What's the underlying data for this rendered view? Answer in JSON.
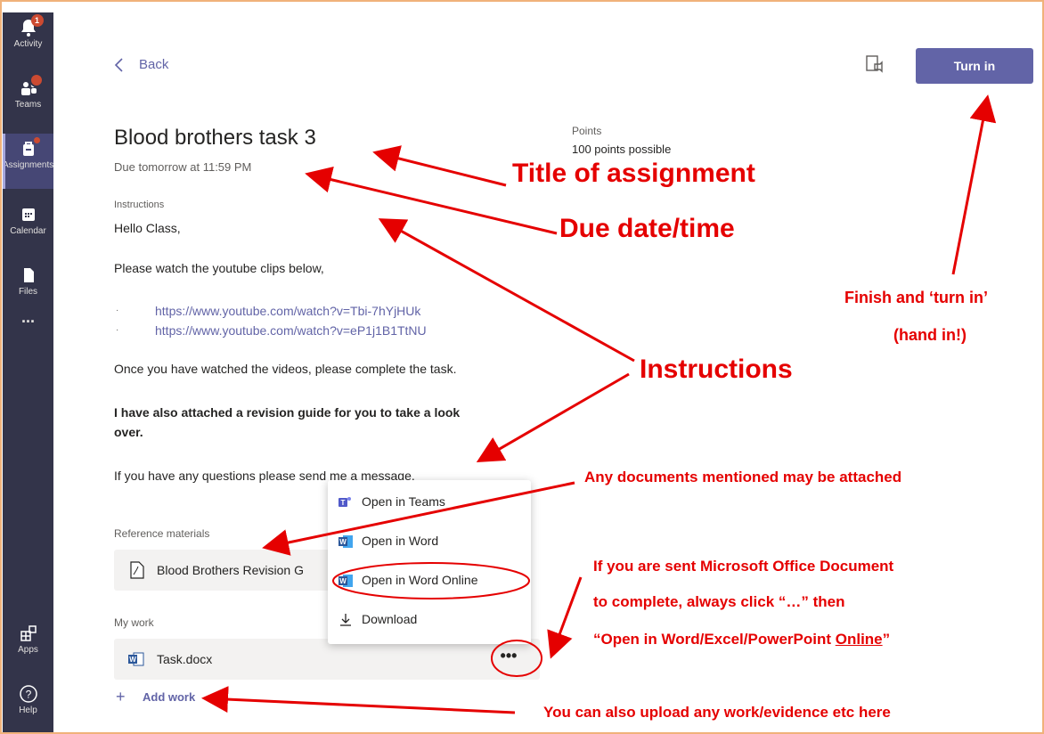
{
  "rail": {
    "items": [
      {
        "label": "Activity",
        "badge": "1"
      },
      {
        "label": "Teams"
      },
      {
        "label": "Assignments"
      },
      {
        "label": "Calendar"
      },
      {
        "label": "Files"
      },
      {
        "label": "..."
      },
      {
        "label": "Apps"
      },
      {
        "label": "Help"
      }
    ]
  },
  "header": {
    "back_label": "Back",
    "turn_in_label": "Turn in"
  },
  "assignment": {
    "title": "Blood brothers task 3",
    "due": "Due tomorrow at 11:59 PM",
    "points_label": "Points",
    "points_value": "100 points possible",
    "instructions_label": "Instructions",
    "greeting": "Hello Class,",
    "line1": "Please watch the youtube clips below,",
    "links": [
      "https://www.youtube.com/watch?v=Tbi-7hYjHUk",
      "https://www.youtube.com/watch?v=eP1j1B1TtNU"
    ],
    "bullet": "·",
    "line2": "Once you have watched the videos, please complete the task.",
    "line3a": "I have also attached a revision guide for you to take a look",
    "line3b": "over.",
    "line4": "If you have any questions please send me a message."
  },
  "reference": {
    "label": "Reference materials",
    "file": "Blood Brothers Revision G"
  },
  "my_work": {
    "label": "My work",
    "file": "Task.docx",
    "more": "•••",
    "add_label": "Add work"
  },
  "menu": {
    "items": [
      "Open in Teams",
      "Open in Word",
      "Open in Word Online",
      "Download"
    ]
  },
  "annotations": {
    "title": "Title of assignment",
    "due": "Due date/time",
    "finish1": "Finish and ‘turn in’",
    "finish2": "(hand in!)",
    "instructions": "Instructions",
    "attached": "Any documents mentioned may be attached",
    "office1": "If you are sent Microsoft Office Document",
    "office2": "to complete, always click “…” then",
    "office3a": "“Open in Word/Excel/PowerPoint ",
    "office3b": "Online",
    "office3c": "”",
    "upload": "You can also upload any work/evidence etc here"
  },
  "colors": {
    "accent": "#6264a7",
    "rail": "#33344a",
    "annotation": "#e50000"
  }
}
